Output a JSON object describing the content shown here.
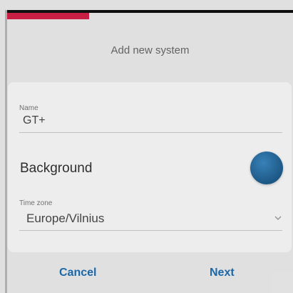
{
  "header": {
    "title": "Add new system",
    "progress_fraction": 0.28
  },
  "form": {
    "name": {
      "label": "Name",
      "value": "GT+"
    },
    "background": {
      "label": "Background",
      "color": "#1f6496"
    },
    "time_zone": {
      "label": "Time zone",
      "value": "Europe/Vilnius"
    }
  },
  "actions": {
    "cancel_label": "Cancel",
    "next_label": "Next"
  },
  "colors": {
    "accent": "#1f6fb5",
    "progress": "#d8234b"
  },
  "icons": {
    "dropdown": "chevron-down-icon"
  }
}
